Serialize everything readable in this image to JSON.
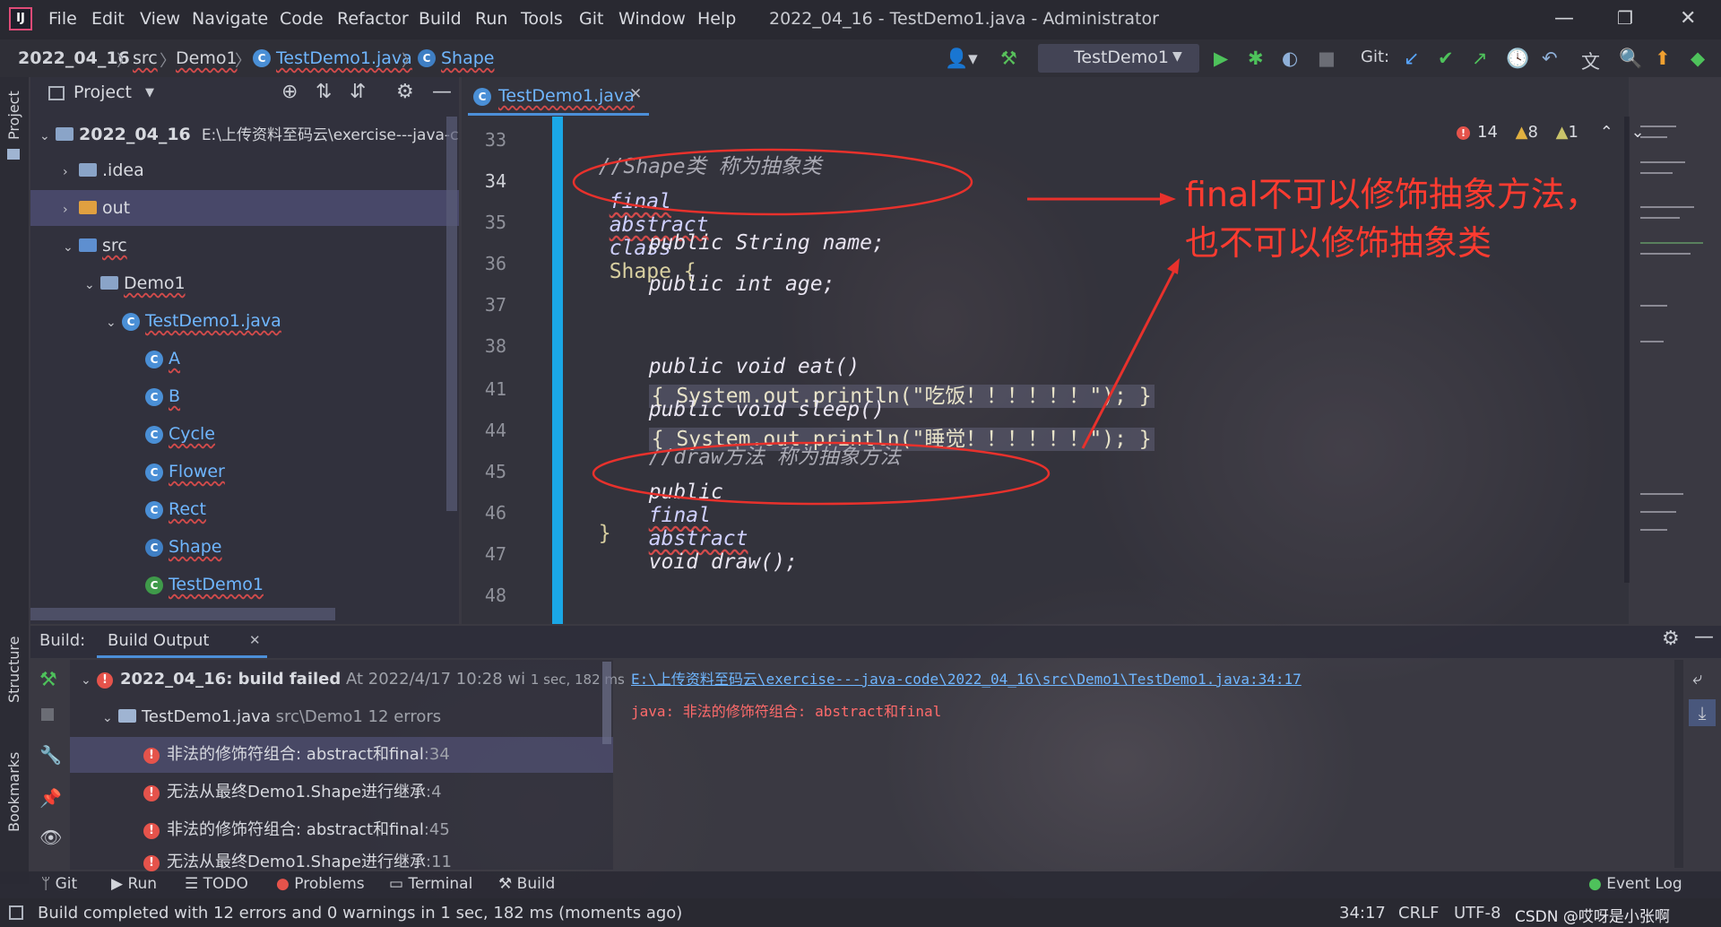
{
  "window": {
    "title": "2022_04_16 - TestDemo1.java - Administrator",
    "menu": [
      "File",
      "Edit",
      "View",
      "Navigate",
      "Code",
      "Refactor",
      "Build",
      "Run",
      "Tools",
      "Git",
      "Window",
      "Help"
    ]
  },
  "breadcrumb": [
    "2022_04_16",
    "src",
    "Demo1",
    "TestDemo1.java",
    "Shape"
  ],
  "toolbar": {
    "run_config": "TestDemo1",
    "git_label": "Git:"
  },
  "left_strip": {
    "project": "Project",
    "structure": "Structure",
    "bookmarks": "Bookmarks"
  },
  "project_panel": {
    "title": "Project",
    "tree": [
      {
        "label": "2022_04_16",
        "extra": "E:\\上传资料至码云\\exercise---java-c",
        "kind": "module"
      },
      {
        "label": ".idea",
        "kind": "folder"
      },
      {
        "label": "out",
        "kind": "folder"
      },
      {
        "label": "src",
        "kind": "folder"
      },
      {
        "label": "Demo1",
        "kind": "package"
      },
      {
        "label": "TestDemo1.java",
        "kind": "file"
      },
      {
        "label": "A",
        "kind": "class"
      },
      {
        "label": "B",
        "kind": "class"
      },
      {
        "label": "Cycle",
        "kind": "class"
      },
      {
        "label": "Flower",
        "kind": "class"
      },
      {
        "label": "Rect",
        "kind": "class"
      },
      {
        "label": "Shape",
        "kind": "class"
      },
      {
        "label": "TestDemo1",
        "kind": "class"
      }
    ]
  },
  "editor": {
    "tab": "TestDemo1.java",
    "line_numbers": [
      "33",
      "34",
      "35",
      "36",
      "37",
      "38",
      "41",
      "44",
      "45",
      "46",
      "47",
      "48"
    ],
    "inspections": {
      "errors": "14",
      "warnings": "8",
      "weak": "1"
    },
    "code": {
      "l33": "//Shape类 称为抽象类",
      "l34_a": "final",
      "l34_b": "abstract",
      "l34_c": "class",
      "l34_d": "Shape {",
      "l35": "public String name;",
      "l36": "public int age;",
      "l38_a": "public void eat()",
      "l38_b": "{ System.out.println(\"吃饭！！！！！！\"); }",
      "l41_a": "public void sleep()",
      "l41_b": "{ System.out.println(\"睡觉！！！！！！\"); }",
      "l44": "//draw方法 称为抽象方法",
      "l45_a": "public",
      "l45_b": "final",
      "l45_c": "abstract",
      "l45_d": "void draw();",
      "l46": "}"
    },
    "annotation_line1": "final不可以修饰抽象方法，",
    "annotation_line2": "也不可以修饰抽象类"
  },
  "build": {
    "label": "Build:",
    "tab": "Build Output",
    "root": "2022_04_16: build failed",
    "root_meta": "At 2022/4/17 10:28 wi",
    "root_time": "1 sec, 182 ms",
    "file": "TestDemo1.java",
    "file_meta": "src\\Demo1 12 errors",
    "errors": [
      {
        "msg": "非法的修饰符组合: abstract和final",
        "line": ":34"
      },
      {
        "msg": "无法从最终Demo1.Shape进行继承",
        "line": ":4"
      },
      {
        "msg": "非法的修饰符组合: abstract和final",
        "line": ":45"
      },
      {
        "msg": "无法从最终Demo1.Shape进行继承",
        "line": ":11"
      }
    ],
    "output_path": "E:\\上传资料至码云\\exercise---java-code\\2022_04_16\\src\\Demo1\\TestDemo1.java:34:17",
    "output_error": "java: 非法的修饰符组合: abstract和final"
  },
  "bottom_tabs": [
    "Git",
    "Run",
    "TODO",
    "Problems",
    "Terminal",
    "Build"
  ],
  "event_log": "Event Log",
  "status": {
    "message": "Build completed with 12 errors and 0 warnings in 1 sec, 182 ms (moments ago)",
    "position": "34:17",
    "line_sep": "CRLF",
    "encoding": "UTF-8",
    "watermark": "CSDN @哎呀是小张啊"
  },
  "colors": {
    "accent_blue": "#4c8fd8",
    "error_red": "#e5534b",
    "annotation_red": "#ff3b30",
    "gutter_cyan": "#1aa7e6"
  }
}
